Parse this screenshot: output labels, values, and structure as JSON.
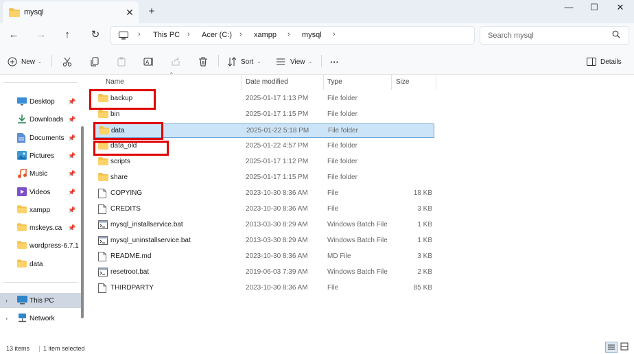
{
  "window": {
    "tab_title": "mysql",
    "new_tab": "+",
    "close_tab": "✕",
    "minimize": "—",
    "maximize": "☐",
    "close": "✕"
  },
  "nav": {
    "back": "←",
    "forward": "→",
    "up": "↑",
    "refresh": "↻",
    "breadcrumb": [
      "This PC",
      "Acer (C:)",
      "xampp",
      "mysql"
    ],
    "separator": "›",
    "search_placeholder": "Search mysql"
  },
  "toolbar": {
    "new_label": "New",
    "sort_label": "Sort",
    "view_label": "View",
    "more_label": "···",
    "details_label": "Details"
  },
  "sidebar": {
    "pinned": [
      {
        "label": "Desktop",
        "icon": "desktop-icon"
      },
      {
        "label": "Downloads",
        "icon": "download-icon"
      },
      {
        "label": "Documents",
        "icon": "documents-icon"
      },
      {
        "label": "Pictures",
        "icon": "pictures-icon"
      },
      {
        "label": "Music",
        "icon": "music-icon"
      },
      {
        "label": "Videos",
        "icon": "videos-icon"
      },
      {
        "label": "xampp",
        "icon": "folder-icon"
      },
      {
        "label": "mskeys.ca",
        "icon": "folder-icon"
      },
      {
        "label": "wordpress-6.7.1",
        "icon": "folder-icon"
      },
      {
        "label": "data",
        "icon": "folder-icon"
      }
    ],
    "this_pc": "This PC",
    "network": "Network"
  },
  "columns": {
    "name": "Name",
    "date": "Date modified",
    "type": "Type",
    "size": "Size"
  },
  "files": [
    {
      "name": "backup",
      "date": "2025-01-17 1:13 PM",
      "type": "File folder",
      "size": "",
      "kind": "folder"
    },
    {
      "name": "bin",
      "date": "2025-01-17 1:15 PM",
      "type": "File folder",
      "size": "",
      "kind": "folder"
    },
    {
      "name": "data",
      "date": "2025-01-22 5:18 PM",
      "type": "File folder",
      "size": "",
      "kind": "folder"
    },
    {
      "name": "data_old",
      "date": "2025-01-22 4:57 PM",
      "type": "File folder",
      "size": "",
      "kind": "folder"
    },
    {
      "name": "scripts",
      "date": "2025-01-17 1:12 PM",
      "type": "File folder",
      "size": "",
      "kind": "folder"
    },
    {
      "name": "share",
      "date": "2025-01-17 1:15 PM",
      "type": "File folder",
      "size": "",
      "kind": "folder"
    },
    {
      "name": "COPYING",
      "date": "2023-10-30 8:36 AM",
      "type": "File",
      "size": "18 KB",
      "kind": "file"
    },
    {
      "name": "CREDITS",
      "date": "2023-10-30 8:36 AM",
      "type": "File",
      "size": "3 KB",
      "kind": "file"
    },
    {
      "name": "mysql_installservice.bat",
      "date": "2013-03-30 8:29 AM",
      "type": "Windows Batch File",
      "size": "1 KB",
      "kind": "bat"
    },
    {
      "name": "mysql_uninstallservice.bat",
      "date": "2013-03-30 8:29 AM",
      "type": "Windows Batch File",
      "size": "1 KB",
      "kind": "bat"
    },
    {
      "name": "README.md",
      "date": "2023-10-30 8:36 AM",
      "type": "MD File",
      "size": "3 KB",
      "kind": "file"
    },
    {
      "name": "resetroot.bat",
      "date": "2019-06-03 7:39 AM",
      "type": "Windows Batch File",
      "size": "2 KB",
      "kind": "bat"
    },
    {
      "name": "THIRDPARTY",
      "date": "2023-10-30 8:36 AM",
      "type": "File",
      "size": "85 KB",
      "kind": "file"
    }
  ],
  "status": {
    "count": "13 items",
    "selected": "1 item selected"
  },
  "colors": {
    "folder": "#f4c04e",
    "selection": "#cce4f7",
    "highlight_box": "#e00000"
  }
}
